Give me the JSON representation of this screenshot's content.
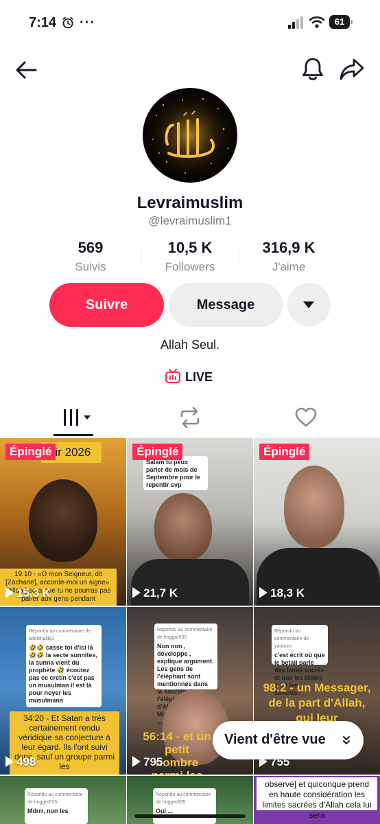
{
  "status_bar": {
    "time": "7:14",
    "battery": "61"
  },
  "profile": {
    "display_name": "Levraimuslim",
    "username": "@levraimuslim1",
    "bio": "Allah Seul.",
    "live_label": "LIVE"
  },
  "stats": [
    {
      "value": "569",
      "label": "Suivis"
    },
    {
      "value": "10,5 K",
      "label": "Followers"
    },
    {
      "value": "316,9 K",
      "label": "J'aime"
    }
  ],
  "actions": {
    "follow": "Suivre",
    "message": "Message"
  },
  "tabs": [
    {
      "icon": "videos-grid-icon"
    },
    {
      "icon": "repost-icon"
    },
    {
      "icon": "heart-outline-icon"
    }
  ],
  "videos": [
    {
      "pinned": "Épinglé",
      "views": "15,3 K",
      "overlay_top": "tir 2026",
      "caption": "19:10 - «O mon Seigneur, dit [Zacharie], accorde-moi un signe». [Allah,] sera que tu ne pourras pas parler aux gens pendant"
    },
    {
      "pinned": "Épinglé",
      "views": "21,7 K",
      "comment": "Salam tu peux parler de mois de Septembre pour le repentir svp"
    },
    {
      "pinned": "Épinglé",
      "views": "18,3 K"
    },
    {
      "views": "498",
      "comment_header": "Répondu au commentaire de adelkhalil81",
      "comment": "🤣🤣 casse toi d'ici là 🤣🤣 la secte sunnites, la sunna vient du prophète 🤣 écoutez pas ce cretin c'est pas un musulman il est là pour noyer les musulmans",
      "caption": "34:20 - Et Satan a très certainement rendu véridique sa conjecture à leur égard. Ils l'ont suivi donc, sauf un groupe parmi les"
    },
    {
      "views": "795",
      "comment_header": "Répondu au commentaire de hoggar535",
      "comment": "Non non , développe , explique argument. Les gens de l'éléphant sont mentionnés dans la sourate de l'éléphant . Au nom d'Allah le Tout Miséricordieux, le ...",
      "caption": "56:14 - et un petit nombre parmi les dernières"
    },
    {
      "views": "755",
      "comment_header": "Répondu au commentaire de yanboro",
      "comment": "c'est écrit où que le betail parle des livres sacrés et que les idoles sont les savants?",
      "caption": "98:2 - un Messager, de la part d'Allah, qui leur"
    },
    {
      "comment_header": "Répondu au commentaire de hoggar535",
      "comment": "Mdrrr, non les"
    },
    {
      "comment_header": "Répondu au commentaire de hoggar535",
      "comment": "Oui ..."
    },
    {
      "caption": "observé] et quiconque prend en haute considération les limites sacrées d'Allah cela lui sera"
    }
  ],
  "just_watched": "Vient d'être vue",
  "colors": {
    "accent": "#fe2c55",
    "caption_bg": "#f1c232"
  }
}
